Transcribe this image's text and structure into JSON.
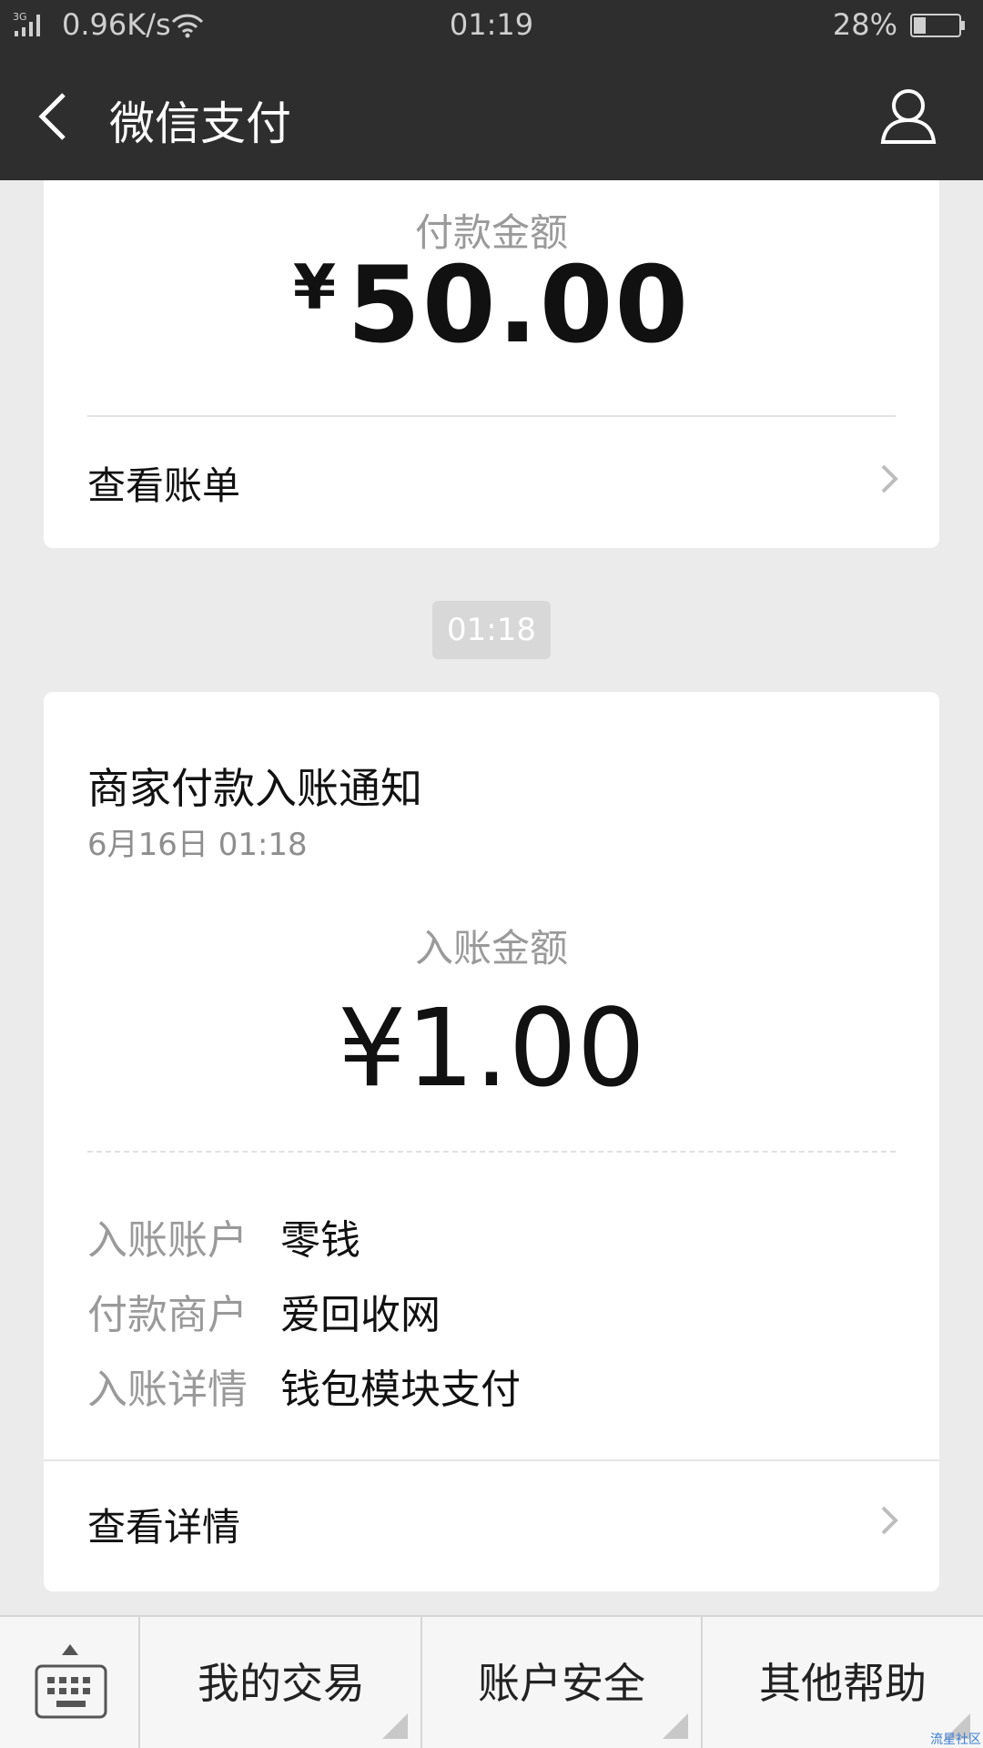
{
  "status_bar": {
    "network": "3G",
    "net_speed": "0.96K/s",
    "time": "01:19",
    "battery": "28%",
    "icons": [
      "signal-icon",
      "wifi-icon",
      "battery-icon"
    ]
  },
  "nav": {
    "title": "微信支付",
    "icons": [
      "back-arrow-icon",
      "profile-icon"
    ]
  },
  "payment_card": {
    "amount_label": "付款金额",
    "currency": "¥",
    "amount": "50.00",
    "link_label": "查看账单"
  },
  "time_divider": "01:18",
  "notice_card": {
    "title": "商家付款入账通知",
    "date": "6月16日  01:18",
    "amount_label": "入账金额",
    "amount": "¥1.00",
    "fields": [
      {
        "key": "入账账户",
        "value": "零钱"
      },
      {
        "key": "付款商户",
        "value": "爱回收网"
      },
      {
        "key": "入账详情",
        "value": "钱包模块支付"
      }
    ],
    "link_label": "查看详情"
  },
  "bottom_menu": {
    "items": [
      "我的交易",
      "账户安全",
      "其他帮助"
    ],
    "watermark": "流星社区"
  },
  "colors": {
    "header_bg": "#2e2e2e",
    "page_bg": "#ebebeb",
    "card_bg": "#ffffff",
    "muted_text": "#9a9a9a"
  }
}
